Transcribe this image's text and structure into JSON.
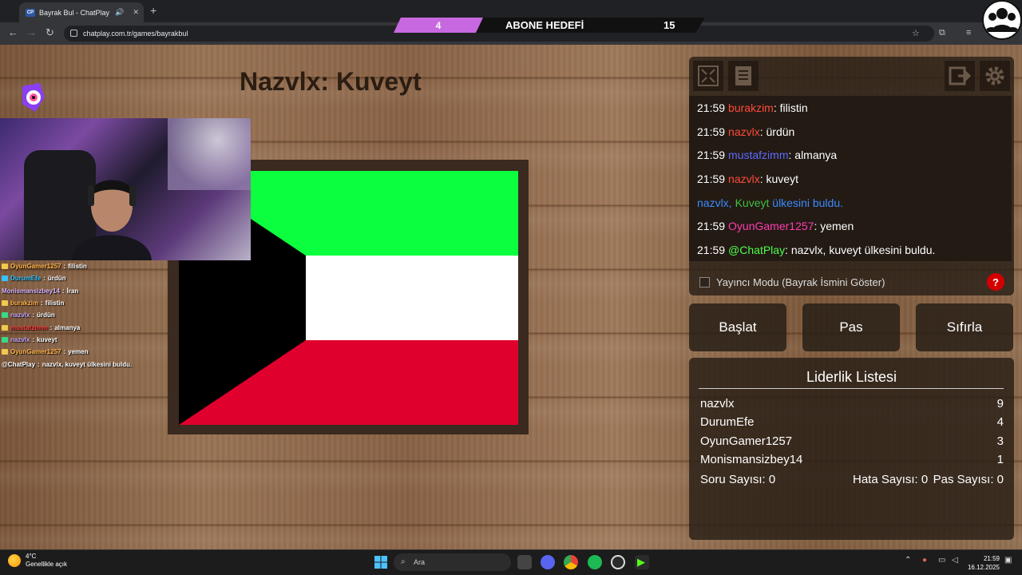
{
  "browser": {
    "tab_title": "Bayrak Bul - ChatPlay",
    "favicon_text": "CP",
    "url": "chatplay.com.tr/games/bayrakbul"
  },
  "goal": {
    "current": "4",
    "label": "ABONE HEDEFİ",
    "target": "15",
    "progress": 0.27
  },
  "question": "Nazvlx: Kuveyt",
  "flag": {
    "colors": {
      "green": "#0cff3e",
      "white": "#ffffff",
      "red": "#e0002d",
      "black": "#000000"
    }
  },
  "overlay_chat": [
    {
      "user": "OyunGamer1257",
      "text": "filistin",
      "color": "#ffb347",
      "badge": "#f2c94c"
    },
    {
      "user": "DurumEfe",
      "text": "ürdün",
      "color": "#33c3ff",
      "badge": "#33c3ff"
    },
    {
      "user": "Monismansizbey14",
      "text": "İran",
      "color": "#d6b3ff",
      "badge": ""
    },
    {
      "user": "burakzim",
      "text": "filistin",
      "color": "#ffb347",
      "badge": "#f2c94c"
    },
    {
      "user": "nazvlx",
      "text": "ürdün",
      "color": "#c4a4ff",
      "badge": "#39d98a"
    },
    {
      "user": "mustafzimm",
      "text": "almanya",
      "color": "#ff3b3b",
      "badge": "#f2c94c"
    },
    {
      "user": "nazvlx",
      "text": "kuveyt",
      "color": "#c4a4ff",
      "badge": "#39d98a"
    },
    {
      "user": "OyunGamer1257",
      "text": "yemen",
      "color": "#ffb347",
      "badge": "#f2c94c"
    },
    {
      "user": "@ChatPlay",
      "text": "nazvlx, kuveyt ülkesini buldu.",
      "color": "#ffffff",
      "badge": ""
    }
  ],
  "chat": {
    "messages": [
      {
        "time": "21:59",
        "user": "burakzim",
        "user_color": "#ff4a3d",
        "text": ": filistin"
      },
      {
        "time": "21:59",
        "user": "nazvlx",
        "user_color": "#ff4a3d",
        "text": ": ürdün"
      },
      {
        "time": "21:59",
        "user": "mustafzimm",
        "user_color": "#5b6bff",
        "text": ": almanya"
      },
      {
        "time": "21:59",
        "user": "nazvlx",
        "user_color": "#ff4a3d",
        "text": ": kuveyt"
      },
      {
        "time": "",
        "user": "nazvlx,",
        "user_color": "#3b8bff",
        "country": "Kuveyt",
        "country_color": "#3fbf3f",
        "text": " ülkesini buldu.",
        "text_color": "#3b8bff"
      },
      {
        "time": "21:59",
        "user": "OyunGamer1257",
        "user_color": "#ff3cb3",
        "text": ": yemen"
      },
      {
        "time": "21:59",
        "user": "@ChatPlay",
        "user_color": "#4cff4c",
        "text": ": nazvlx, kuveyt ülkesini buldu."
      }
    ]
  },
  "streamer_mode_label": "Yayıncı Modu (Bayrak İsmini Göster)",
  "help_label": "?",
  "buttons": {
    "start": "Başlat",
    "pass": "Pas",
    "reset": "Sıfırla"
  },
  "leaderboard": {
    "title": "Liderlik Listesi",
    "rows": [
      {
        "name": "nazvlx",
        "score": "9"
      },
      {
        "name": "DurumEfe",
        "score": "4"
      },
      {
        "name": "OyunGamer1257",
        "score": "3"
      },
      {
        "name": "Monismansizbey14",
        "score": "1"
      }
    ],
    "stats": {
      "questions": "Soru Sayısı: 0",
      "errors": "Hata Sayısı: 0",
      "passes": "Pas Sayısı: 0"
    }
  },
  "taskbar": {
    "temp": "4°C",
    "weather": "Genellikle açık",
    "search_placeholder": "Ara",
    "time": "21:59",
    "date": "16.12.2025"
  }
}
